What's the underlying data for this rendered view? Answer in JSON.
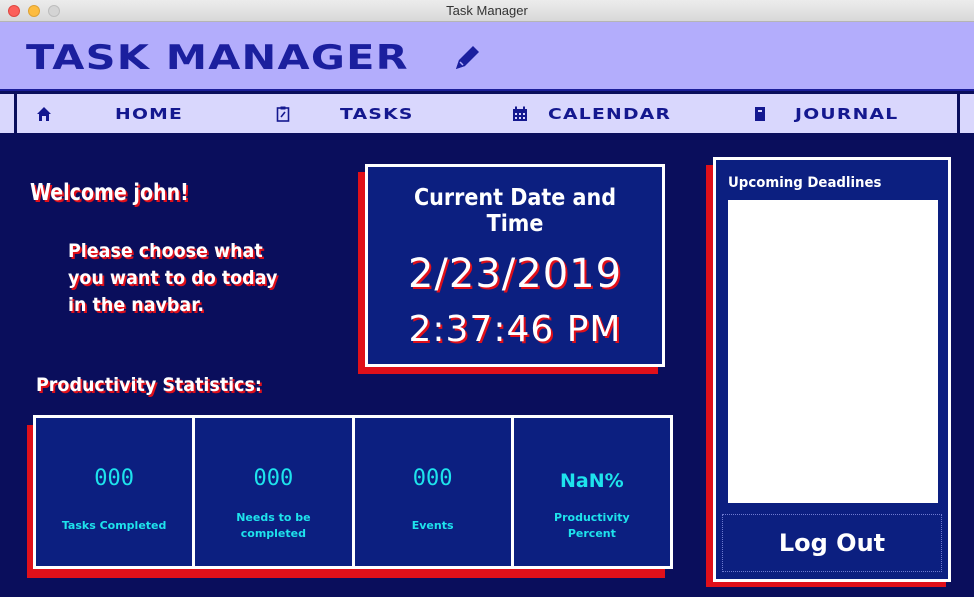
{
  "window": {
    "title": "Task Manager"
  },
  "header": {
    "brand": "TASK MANAGER",
    "brand_icon": "pencil-icon"
  },
  "navbar": {
    "items": [
      {
        "label": "HOME",
        "icon": "home-icon"
      },
      {
        "label": "TASKS",
        "icon": "clipboard-icon"
      },
      {
        "label": "CALENDAR",
        "icon": "calendar-icon"
      },
      {
        "label": "JOURNAL",
        "icon": "book-icon"
      }
    ]
  },
  "main": {
    "welcome": "Welcome john!",
    "instructions": "Please choose what you want to do today in the navbar.",
    "datetime": {
      "title": "Current Date and Time",
      "date": "2/23/2019",
      "time": "2:37:46 PM"
    },
    "stats_title": "Productivity Statistics:",
    "stats": [
      {
        "value": "000",
        "label": "Tasks Completed"
      },
      {
        "value": "000",
        "label": "Needs to be completed"
      },
      {
        "value": "000",
        "label": "Events"
      },
      {
        "value": "NaN%",
        "label": "Productivity Percent"
      }
    ]
  },
  "sidebar": {
    "title": "Upcoming Deadlines",
    "logout_label": "Log Out"
  },
  "colors": {
    "background": "#0a0e5c",
    "header": "#b3adfc",
    "navbar": "#d9d7fd",
    "accent_red": "#e0101a",
    "stat_cyan": "#1ee3ec"
  }
}
